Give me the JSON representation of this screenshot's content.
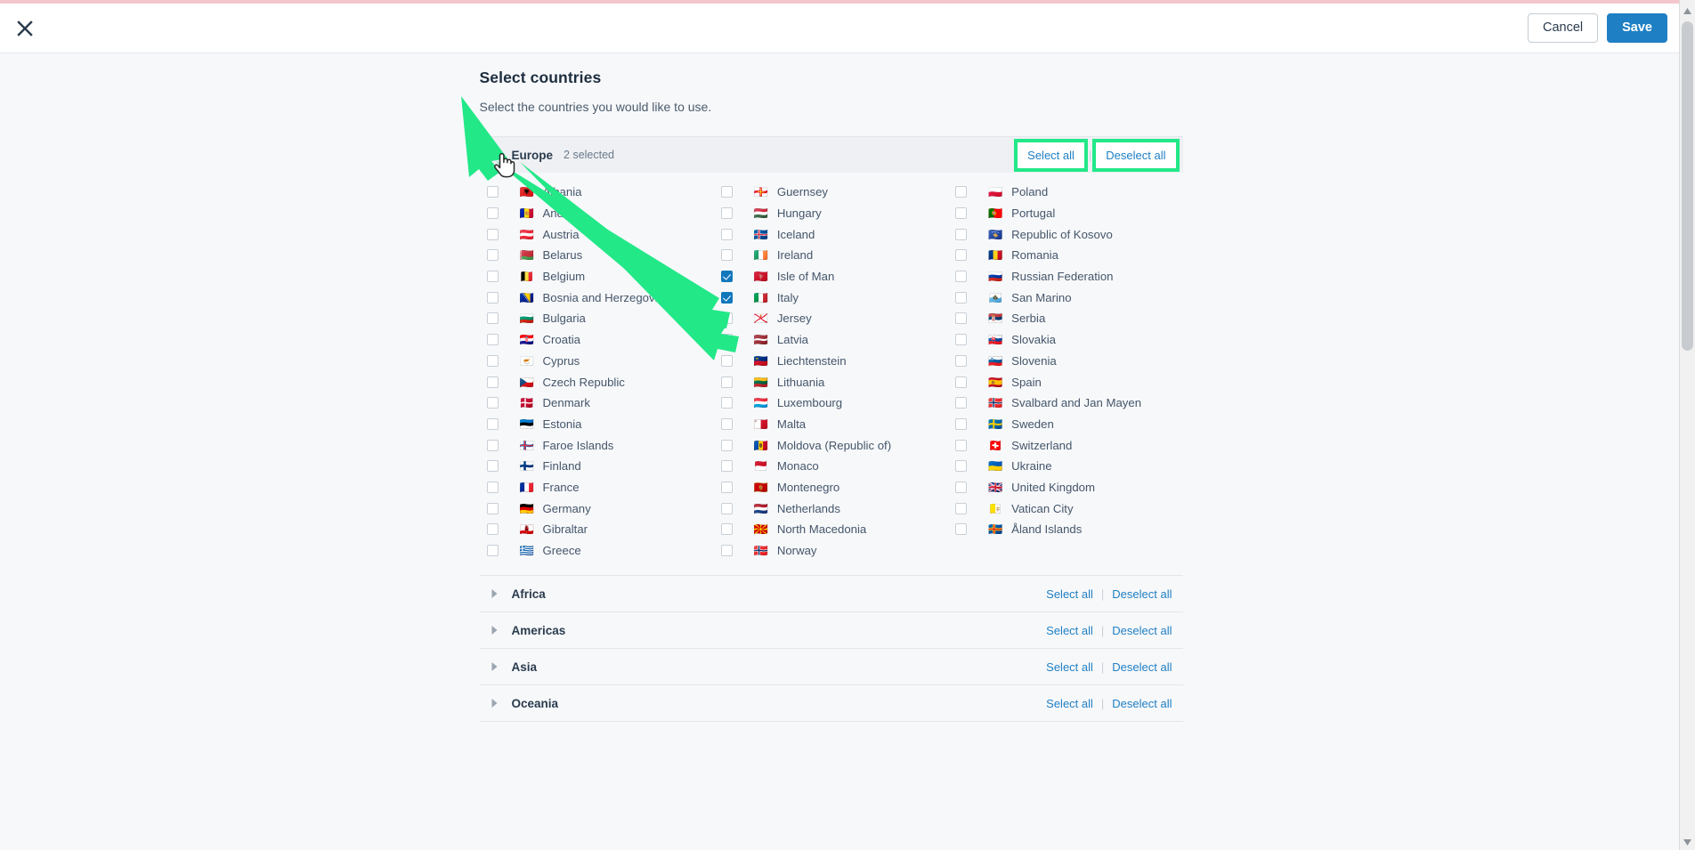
{
  "topbar": {
    "close_icon": "close-icon",
    "cancel_label": "Cancel",
    "save_label": "Save"
  },
  "page": {
    "title": "Select countries",
    "subtitle": "Select the countries you would like to use."
  },
  "actions": {
    "select_all": "Select all",
    "deselect_all": "Deselect all",
    "separator": "|"
  },
  "regions": [
    {
      "name": "Europe",
      "count_label": "2 selected",
      "expanded": true,
      "annotated_actions": true,
      "countries": [
        {
          "name": "Albania",
          "flag": "🇦🇱",
          "checked": false
        },
        {
          "name": "Andorra",
          "flag": "🇦🇩",
          "checked": false
        },
        {
          "name": "Austria",
          "flag": "🇦🇹",
          "checked": false
        },
        {
          "name": "Belarus",
          "flag": "🇧🇾",
          "checked": false
        },
        {
          "name": "Belgium",
          "flag": "🇧🇪",
          "checked": false
        },
        {
          "name": "Bosnia and Herzegovina",
          "flag": "🇧🇦",
          "checked": false
        },
        {
          "name": "Bulgaria",
          "flag": "🇧🇬",
          "checked": false
        },
        {
          "name": "Croatia",
          "flag": "🇭🇷",
          "checked": false
        },
        {
          "name": "Cyprus",
          "flag": "🇨🇾",
          "checked": false
        },
        {
          "name": "Czech Republic",
          "flag": "🇨🇿",
          "checked": false
        },
        {
          "name": "Denmark",
          "flag": "🇩🇰",
          "checked": false
        },
        {
          "name": "Estonia",
          "flag": "🇪🇪",
          "checked": false
        },
        {
          "name": "Faroe Islands",
          "flag": "🇫🇴",
          "checked": false
        },
        {
          "name": "Finland",
          "flag": "🇫🇮",
          "checked": false
        },
        {
          "name": "France",
          "flag": "🇫🇷",
          "checked": false
        },
        {
          "name": "Germany",
          "flag": "🇩🇪",
          "checked": false
        },
        {
          "name": "Gibraltar",
          "flag": "🇬🇮",
          "checked": false
        },
        {
          "name": "Greece",
          "flag": "🇬🇷",
          "checked": false
        },
        {
          "name": "Guernsey",
          "flag": "🇬🇬",
          "checked": false
        },
        {
          "name": "Hungary",
          "flag": "🇭🇺",
          "checked": false
        },
        {
          "name": "Iceland",
          "flag": "🇮🇸",
          "checked": false
        },
        {
          "name": "Ireland",
          "flag": "🇮🇪",
          "checked": false
        },
        {
          "name": "Isle of Man",
          "flag": "🇮🇲",
          "checked": true
        },
        {
          "name": "Italy",
          "flag": "🇮🇹",
          "checked": true
        },
        {
          "name": "Jersey",
          "flag": "🇯🇪",
          "checked": false
        },
        {
          "name": "Latvia",
          "flag": "🇱🇻",
          "checked": false
        },
        {
          "name": "Liechtenstein",
          "flag": "🇱🇮",
          "checked": false
        },
        {
          "name": "Lithuania",
          "flag": "🇱🇹",
          "checked": false
        },
        {
          "name": "Luxembourg",
          "flag": "🇱🇺",
          "checked": false
        },
        {
          "name": "Malta",
          "flag": "🇲🇹",
          "checked": false
        },
        {
          "name": "Moldova (Republic of)",
          "flag": "🇲🇩",
          "checked": false
        },
        {
          "name": "Monaco",
          "flag": "🇲🇨",
          "checked": false
        },
        {
          "name": "Montenegro",
          "flag": "🇲🇪",
          "checked": false
        },
        {
          "name": "Netherlands",
          "flag": "🇳🇱",
          "checked": false
        },
        {
          "name": "North Macedonia",
          "flag": "🇲🇰",
          "checked": false
        },
        {
          "name": "Norway",
          "flag": "🇳🇴",
          "checked": false
        },
        {
          "name": "Poland",
          "flag": "🇵🇱",
          "checked": false
        },
        {
          "name": "Portugal",
          "flag": "🇵🇹",
          "checked": false
        },
        {
          "name": "Republic of Kosovo",
          "flag": "🇽🇰",
          "checked": false
        },
        {
          "name": "Romania",
          "flag": "🇷🇴",
          "checked": false
        },
        {
          "name": "Russian Federation",
          "flag": "🇷🇺",
          "checked": false
        },
        {
          "name": "San Marino",
          "flag": "🇸🇲",
          "checked": false
        },
        {
          "name": "Serbia",
          "flag": "🇷🇸",
          "checked": false
        },
        {
          "name": "Slovakia",
          "flag": "🇸🇰",
          "checked": false
        },
        {
          "name": "Slovenia",
          "flag": "🇸🇮",
          "checked": false
        },
        {
          "name": "Spain",
          "flag": "🇪🇸",
          "checked": false
        },
        {
          "name": "Svalbard and Jan Mayen",
          "flag": "🇸🇯",
          "checked": false
        },
        {
          "name": "Sweden",
          "flag": "🇸🇪",
          "checked": false
        },
        {
          "name": "Switzerland",
          "flag": "🇨🇭",
          "checked": false
        },
        {
          "name": "Ukraine",
          "flag": "🇺🇦",
          "checked": false
        },
        {
          "name": "United Kingdom",
          "flag": "🇬🇧",
          "checked": false
        },
        {
          "name": "Vatican City",
          "flag": "🇻🇦",
          "checked": false
        },
        {
          "name": "Åland Islands",
          "flag": "🇦🇽",
          "checked": false
        }
      ]
    },
    {
      "name": "Africa",
      "count_label": "",
      "expanded": false,
      "annotated_actions": false,
      "countries": []
    },
    {
      "name": "Americas",
      "count_label": "",
      "expanded": false,
      "annotated_actions": false,
      "countries": []
    },
    {
      "name": "Asia",
      "count_label": "",
      "expanded": false,
      "annotated_actions": false,
      "countries": []
    },
    {
      "name": "Oceania",
      "count_label": "",
      "expanded": false,
      "annotated_actions": false,
      "countries": []
    }
  ],
  "colors": {
    "accent_blue": "#1f7fc4",
    "checkbox_checked": "#1278bc",
    "annotation_green": "#22e888",
    "top_accent": "#f5c6ce",
    "page_bg": "#f7f8fa",
    "expanded_row_bg": "#eef0f3"
  }
}
